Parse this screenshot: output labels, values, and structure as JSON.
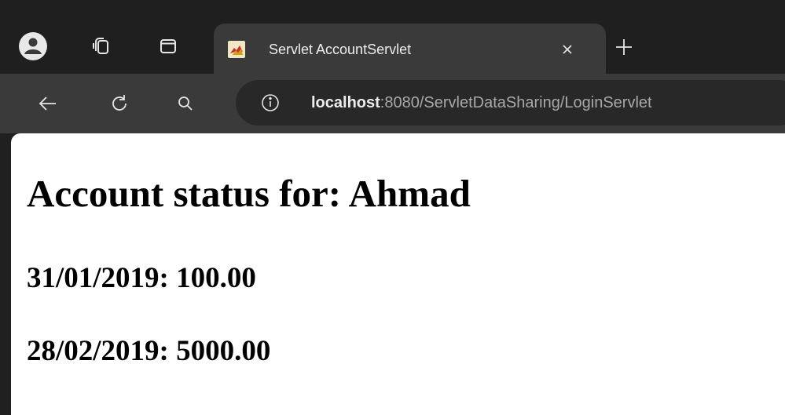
{
  "browser": {
    "tab": {
      "title": "Servlet AccountServlet"
    },
    "address_bar": {
      "host": "localhost",
      "path": ":8080/ServletDataSharing/LoginServlet"
    },
    "icons": {
      "profile": "profile-icon",
      "workspaces": "workspaces-icon",
      "tab_actions": "tab-actions-icon",
      "favicon": "tomcat-favicon",
      "close_tab": "close-icon",
      "new_tab": "plus-icon",
      "back": "back-arrow-icon",
      "reload": "reload-icon",
      "search": "search-icon",
      "site_info": "info-icon"
    }
  },
  "page": {
    "heading": "Account status for: Ahmad",
    "entries": [
      {
        "text": "31/01/2019: 100.00"
      },
      {
        "text": "28/02/2019: 5000.00"
      }
    ]
  }
}
